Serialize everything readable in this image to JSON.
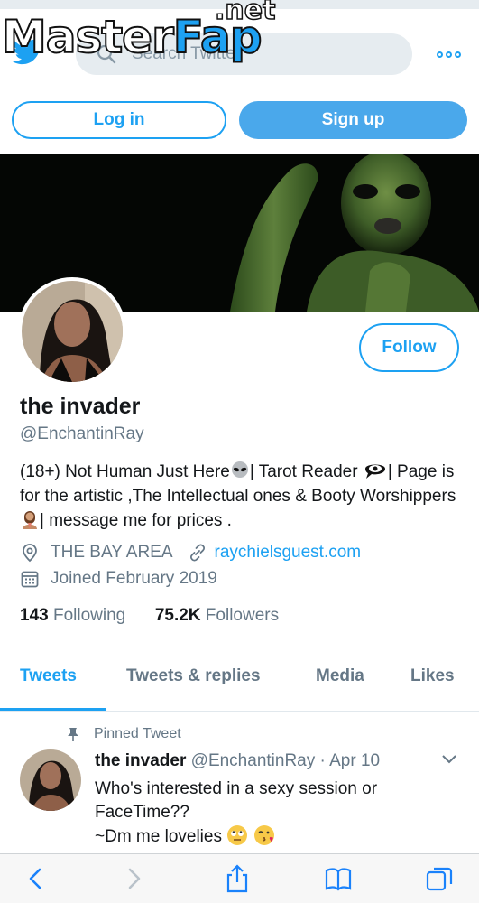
{
  "watermark": {
    "brand_main": "Master",
    "brand_accent": "Fap",
    "brand_tld": ".net"
  },
  "search": {
    "placeholder": "Search Twitter"
  },
  "auth": {
    "login_label": "Log in",
    "signup_label": "Sign up"
  },
  "profile": {
    "follow_label": "Follow",
    "display_name": "the invader",
    "handle": "@EnchantinRay",
    "bio_part1": "(18+) Not Human Just Here",
    "bio_part2": "| Tarot Reader ",
    "bio_part3": "| Page is for the artistic ,The Intellectual ones & Booty Worshippers",
    "bio_part4": "| message me for prices .",
    "location": "THE BAY AREA",
    "website": "raychielsguest.com",
    "joined": "Joined February 2019",
    "following_count": "143",
    "following_label": "Following",
    "followers_count": "75.2K",
    "followers_label": "Followers"
  },
  "tabs": [
    {
      "label": "Tweets",
      "active": true
    },
    {
      "label": "Tweets & replies",
      "active": false
    },
    {
      "label": "Media",
      "active": false
    },
    {
      "label": "Likes",
      "active": false
    }
  ],
  "pinned_tweet": {
    "pinned_label": "Pinned Tweet",
    "author_name": "the invader",
    "author_handle": "@EnchantinRay",
    "separator": "·",
    "date": "Apr 10",
    "text_line1": "Who's interested in a sexy session or FaceTime??",
    "text_line2": "~Dm me lovelies"
  },
  "colors": {
    "accent": "#1da1f2",
    "secondary_text": "#657786",
    "primary_text": "#14171a"
  },
  "icons": [
    "twitter-bird-icon",
    "search-icon",
    "more-icon",
    "location-icon",
    "link-icon",
    "calendar-icon",
    "pin-icon",
    "chevron-down-icon",
    "back-icon",
    "forward-icon",
    "share-icon",
    "bookmarks-icon",
    "tabs-icon"
  ]
}
